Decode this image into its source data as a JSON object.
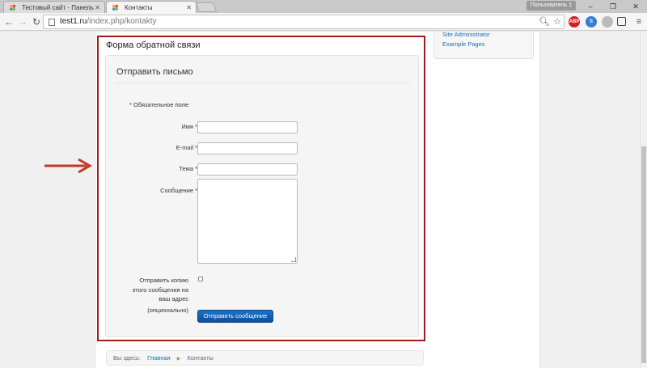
{
  "browser": {
    "tabs": [
      {
        "title": "Тестовый сайт - Панель",
        "active": false
      },
      {
        "title": "Контакты",
        "active": true
      }
    ],
    "user_badge": "Пользователь 1",
    "url_host": "test1.ru",
    "url_path": "/index.php/kontakty",
    "controls": {
      "minimize": "–",
      "maximize": "❐",
      "close": "✕"
    },
    "extensions": [
      "ABP",
      "S",
      "",
      ""
    ]
  },
  "sidebar": {
    "links": [
      "Site Administrator",
      "Example Pages"
    ]
  },
  "page": {
    "heading": "Форма обратной связи"
  },
  "form": {
    "legend": "Отправить письмо",
    "required_note": "* Обязательное поле",
    "fields": {
      "name_label": "Имя *",
      "name_value": "",
      "email_label": "E-mail *",
      "email_value": "",
      "subject_label": "Тема *",
      "subject_value": "",
      "message_label": "Сообщение *",
      "message_value": ""
    },
    "copy_label": "Отправить копию этого сообщения на ваш адрес",
    "copy_optional": "(опционально)",
    "copy_checked": false,
    "submit_label": "Отправить сообщение"
  },
  "breadcrumb": {
    "prefix": "Вы здесь:",
    "home": "Главная",
    "current": "Контакты"
  },
  "colors": {
    "frame_border": "#a11b1b",
    "arrow": "#c0392b",
    "button": "#0b5fb2",
    "link": "#1a6fb5"
  },
  "icons": {
    "tab_favicon": "joomla-icon",
    "back": "back-arrow-icon",
    "forward": "forward-arrow-icon",
    "reload": "reload-icon",
    "zoom": "zoom-icon",
    "bookmark": "star-icon",
    "arrow": "arrow-right-icon"
  }
}
